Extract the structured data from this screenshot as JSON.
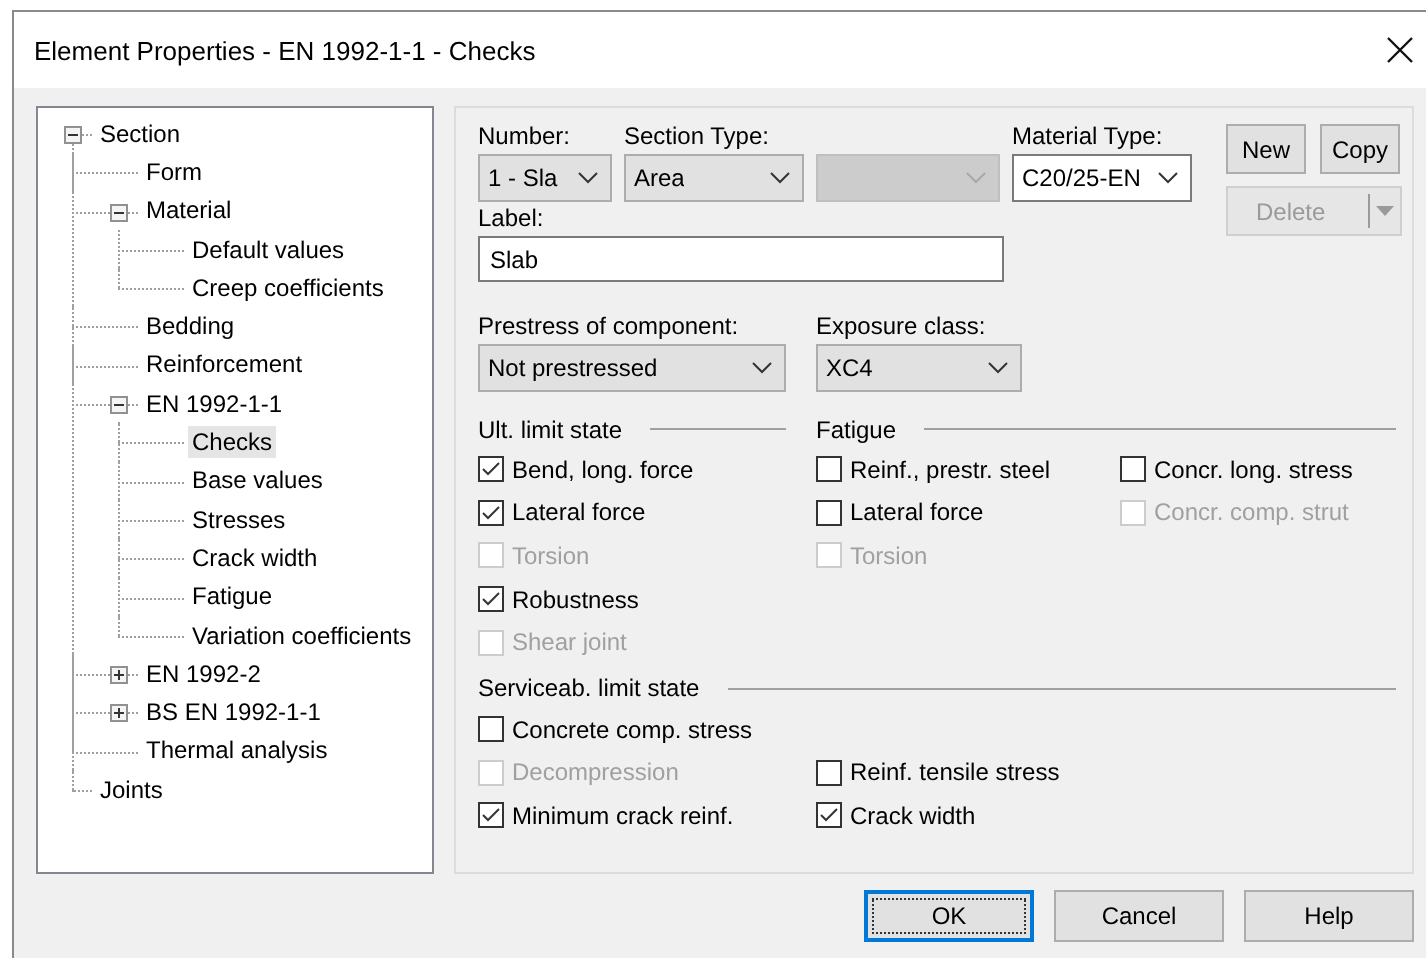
{
  "window": {
    "title": "Element Properties - EN 1992-1-1 - Checks"
  },
  "tree": [
    {
      "label": "Section",
      "expanded": true,
      "selected": false,
      "children": [
        {
          "label": "Form",
          "selected": false
        },
        {
          "label": "Material",
          "expanded": true,
          "selected": false,
          "children": [
            {
              "label": "Default values",
              "selected": false
            },
            {
              "label": "Creep coefficients",
              "selected": false
            }
          ]
        },
        {
          "label": "Bedding",
          "selected": false
        },
        {
          "label": "Reinforcement",
          "selected": false
        },
        {
          "label": "EN 1992-1-1",
          "expanded": true,
          "selected": false,
          "children": [
            {
              "label": "Checks",
              "selected": true
            },
            {
              "label": "Base values",
              "selected": false
            },
            {
              "label": "Stresses",
              "selected": false
            },
            {
              "label": "Crack width",
              "selected": false
            },
            {
              "label": "Fatigue",
              "selected": false
            },
            {
              "label": "Variation coefficients",
              "selected": false
            }
          ]
        },
        {
          "label": "EN 1992-2",
          "expanded": false,
          "selected": false
        },
        {
          "label": "BS EN 1992-1-1",
          "expanded": false,
          "selected": false
        },
        {
          "label": "Thermal analysis",
          "selected": false
        }
      ]
    },
    {
      "label": "Joints",
      "selected": false
    }
  ],
  "combos": [
    {
      "label": "Number:",
      "value": "1 - Sla",
      "kind": "dropdown",
      "disabled": false
    },
    {
      "label": "Section Type:",
      "value": "Area",
      "kind": "dropdown",
      "disabled": false
    },
    {
      "kind": "dropdown",
      "disabled": true
    },
    {
      "label": "Material Type:",
      "value": "C20/25-EN",
      "kind": "editable",
      "disabled": false
    }
  ],
  "side_buttons": [
    {
      "label": "New",
      "kind": "button",
      "disabled": false
    },
    {
      "label": "Copy",
      "kind": "button",
      "disabled": false
    },
    {
      "label": "Delete",
      "kind": "split",
      "disabled": true
    }
  ],
  "label_field": {
    "label": "Label:",
    "value": "Slab"
  },
  "combos_2": [
    {
      "label": "Prestress of component:",
      "value": "Not prestressed",
      "kind": "dropdown",
      "disabled": false
    },
    {
      "label": "Exposure class:",
      "value": "XC4",
      "kind": "dropdown",
      "disabled": false
    }
  ],
  "ult_limit_state": {
    "title": "Ult. limit state",
    "rows": [
      [
        {
          "label": "Bend, long. force",
          "checked": true,
          "disabled": false
        }
      ],
      [
        {
          "label": "Lateral force",
          "checked": true,
          "disabled": false
        }
      ],
      [
        {
          "label": "Torsion",
          "checked": false,
          "disabled": true
        }
      ],
      [
        {
          "label": "Robustness",
          "checked": true,
          "disabled": false
        }
      ],
      [
        {
          "label": "Shear joint",
          "checked": false,
          "disabled": true
        }
      ]
    ]
  },
  "fatigue": {
    "title": "Fatigue",
    "rows": [
      [
        {
          "label": "Reinf., prestr. steel",
          "checked": false,
          "disabled": false
        },
        {
          "label": "Concr. long. stress",
          "checked": false,
          "disabled": false
        }
      ],
      [
        {
          "label": "Lateral force",
          "checked": false,
          "disabled": false
        },
        {
          "label": "Concr. comp. strut",
          "checked": false,
          "disabled": true
        }
      ],
      [
        {
          "label": "Torsion",
          "checked": false,
          "disabled": true
        }
      ]
    ]
  },
  "serviceab_limit_state": {
    "title": "Serviceab. limit state",
    "rows": [
      [
        {
          "label": "Concrete comp. stress",
          "checked": false,
          "disabled": false
        }
      ],
      [
        {
          "label": "Decompression",
          "checked": false,
          "disabled": true
        },
        {
          "label": "Reinf. tensile stress",
          "checked": false,
          "disabled": false
        }
      ],
      [
        {
          "label": "Minimum crack reinf.",
          "checked": true,
          "disabled": false
        },
        {
          "label": "Crack width",
          "checked": true,
          "disabled": false
        }
      ]
    ]
  },
  "dialog_buttons": [
    {
      "label": "OK",
      "default": true
    },
    {
      "label": "Cancel",
      "default": false
    },
    {
      "label": "Help",
      "default": false
    }
  ]
}
